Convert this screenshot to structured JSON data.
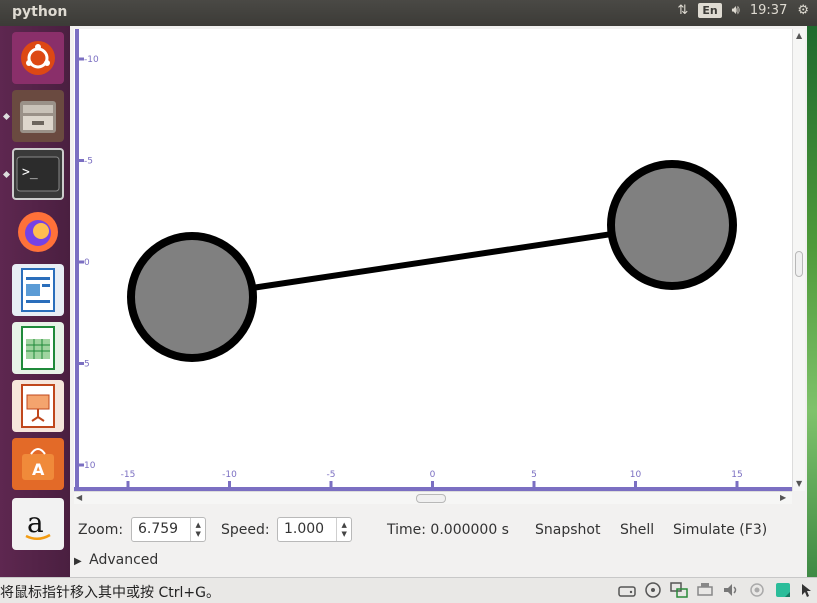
{
  "topbar": {
    "title": "python",
    "lang": "En",
    "time": "19:37"
  },
  "viewer": {
    "x_ticks": [
      "-15",
      "-10",
      "-5",
      "0",
      "5",
      "10",
      "15"
    ],
    "y_ticks": [
      "-10",
      "-5",
      "0",
      "5",
      "10"
    ]
  },
  "controls": {
    "zoom_label": "Zoom:",
    "zoom_value": "6.759",
    "speed_label": "Speed:",
    "speed_value": "1.000",
    "time_text": "Time: 0.000000 s",
    "snapshot": "Snapshot",
    "shell": "Shell",
    "simulate": "Simulate (F3)",
    "advanced": "Advanced"
  },
  "statusbar": {
    "message": "将鼠标指针移入其中或按 Ctrl+G。"
  }
}
